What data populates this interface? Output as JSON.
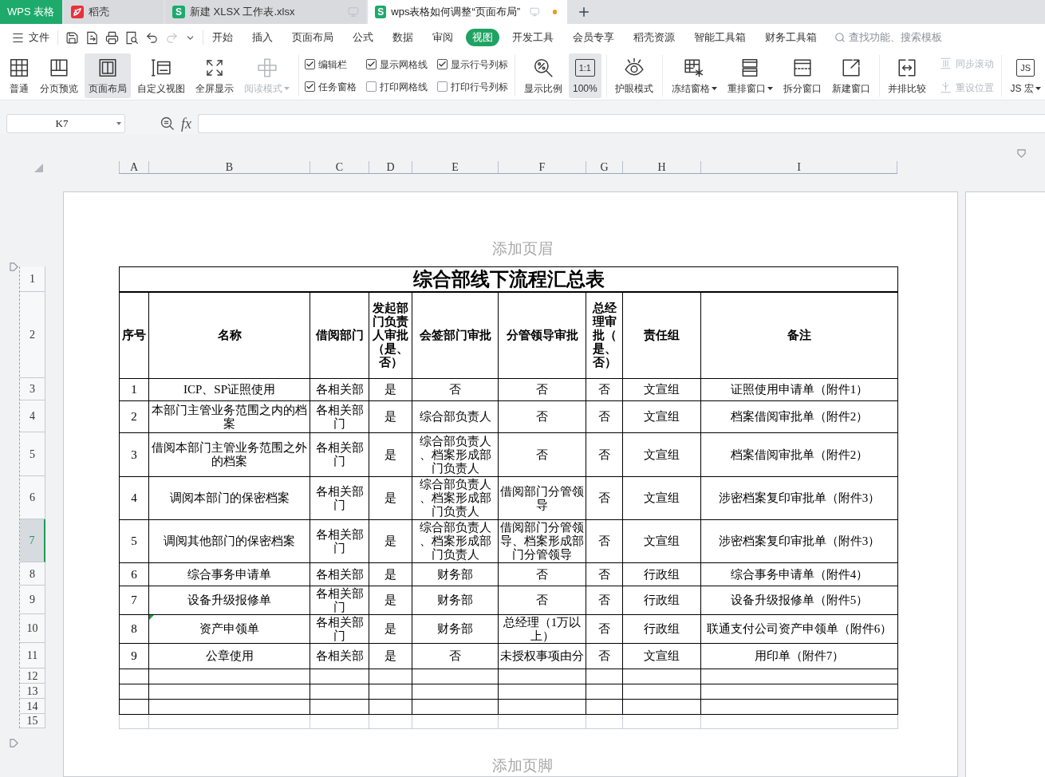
{
  "window_tabs": [
    {
      "kind": "app",
      "label": "WPS 表格",
      "selected": false,
      "unsaved": false
    },
    {
      "kind": "docer",
      "label": "稻壳",
      "selected": false,
      "unsaved": false
    },
    {
      "kind": "sheet",
      "icon_text": "S",
      "label": "新建 XLSX 工作表.xlsx",
      "selected": false,
      "unsaved": false
    },
    {
      "kind": "sheet",
      "icon_text": "S",
      "label": "wps表格如何调整“页面布局”",
      "selected": true,
      "unsaved": true
    }
  ],
  "menu_bar": {
    "file_label": "文件",
    "quick_access": [
      {
        "disabled": false
      },
      {
        "disabled": false
      },
      {
        "disabled": false
      },
      {
        "disabled": false
      },
      {
        "disabled": false
      },
      {
        "disabled": true
      }
    ],
    "tabs": [
      {
        "label": "开始",
        "selected": false
      },
      {
        "label": "插入",
        "selected": false
      },
      {
        "label": "页面布局",
        "selected": false
      },
      {
        "label": "公式",
        "selected": false
      },
      {
        "label": "数据",
        "selected": false
      },
      {
        "label": "审阅",
        "selected": false
      },
      {
        "label": "视图",
        "selected": true
      },
      {
        "label": "开发工具",
        "selected": false
      },
      {
        "label": "会员专享",
        "selected": false
      },
      {
        "label": "稻壳资源",
        "selected": false
      },
      {
        "label": "智能工具箱",
        "selected": false
      },
      {
        "label": "财务工具箱",
        "selected": false
      }
    ],
    "search": {
      "placeholder": "查找功能、搜索模板"
    }
  },
  "ribbon": {
    "groups": [
      {
        "items": [
          {
            "kind": "large",
            "label": "普通",
            "selected": false,
            "disabled": false,
            "has_menu": false
          },
          {
            "kind": "large",
            "label": "分页预览",
            "selected": false,
            "disabled": false,
            "has_menu": false
          },
          {
            "kind": "large",
            "label": "页面布局",
            "selected": true,
            "disabled": false,
            "has_menu": false
          },
          {
            "kind": "large",
            "label": "自定义视图",
            "selected": false,
            "disabled": false,
            "has_menu": false
          },
          {
            "kind": "large",
            "label": "全屏显示",
            "selected": false,
            "disabled": false,
            "has_menu": false
          },
          {
            "kind": "large",
            "label": "阅读模式",
            "selected": false,
            "disabled": true,
            "has_menu": true
          }
        ]
      },
      {
        "items": [
          {
            "kind": "checkbox",
            "label": "编辑栏",
            "checked": true
          },
          {
            "kind": "checkbox",
            "label": "显示网格线",
            "checked": true
          },
          {
            "kind": "checkbox",
            "label": "显示行号列标",
            "checked": true
          },
          {
            "kind": "checkbox",
            "label": "任务窗格",
            "checked": true
          },
          {
            "kind": "checkbox",
            "label": "打印网格线",
            "checked": false
          },
          {
            "kind": "checkbox",
            "label": "打印行号列标",
            "checked": false
          }
        ]
      },
      {
        "items": [
          {
            "kind": "large",
            "label": "显示比例",
            "selected": false,
            "disabled": false,
            "has_menu": false
          },
          {
            "kind": "large",
            "label": "100%",
            "icon_text": "1:1",
            "selected": true,
            "disabled": false,
            "has_menu": false
          }
        ]
      },
      {
        "items": [
          {
            "kind": "large",
            "label": "护眼模式",
            "selected": false,
            "disabled": false,
            "has_menu": false
          }
        ]
      },
      {
        "items": [
          {
            "kind": "large",
            "label": "冻结窗格",
            "selected": false,
            "disabled": false,
            "has_menu": true
          },
          {
            "kind": "large",
            "label": "重排窗口",
            "selected": false,
            "disabled": false,
            "has_menu": true
          },
          {
            "kind": "large",
            "label": "拆分窗口",
            "selected": false,
            "disabled": false,
            "has_menu": false
          },
          {
            "kind": "large",
            "label": "新建窗口",
            "selected": false,
            "disabled": false,
            "has_menu": false
          }
        ]
      },
      {
        "items": [
          {
            "kind": "large",
            "label": "并排比较",
            "selected": false,
            "disabled": false,
            "has_menu": false
          },
          {
            "kind": "small",
            "label": "同步滚动",
            "selected": false,
            "disabled": true,
            "has_menu": false
          },
          {
            "kind": "small",
            "label": "重设位置",
            "selected": false,
            "disabled": true,
            "has_menu": false
          }
        ]
      },
      {
        "items": [
          {
            "kind": "large",
            "label": "JS 宏",
            "icon_text": "JS",
            "selected": false,
            "disabled": false,
            "has_menu": true
          }
        ]
      }
    ]
  },
  "formula_bar": {
    "name_box": "K7",
    "fx_label": "fx"
  },
  "sheet": {
    "column_headers": [
      "A",
      "B",
      "C",
      "D",
      "E",
      "F",
      "G",
      "H",
      "I"
    ],
    "row_headers": [
      {
        "label": "1",
        "selected": false
      },
      {
        "label": "2",
        "selected": false
      },
      {
        "label": "3",
        "selected": false
      },
      {
        "label": "4",
        "selected": false
      },
      {
        "label": "5",
        "selected": false
      },
      {
        "label": "6",
        "selected": false
      },
      {
        "label": "7",
        "selected": true
      },
      {
        "label": "8",
        "selected": false
      },
      {
        "label": "9",
        "selected": false
      },
      {
        "label": "10",
        "selected": false
      },
      {
        "label": "11",
        "selected": false
      },
      {
        "label": "12",
        "selected": false
      },
      {
        "label": "13",
        "selected": false
      },
      {
        "label": "14",
        "selected": false
      },
      {
        "label": "15",
        "selected": false
      }
    ],
    "page_header": "添加页眉",
    "title": "综合部线下流程汇总表",
    "header_cells": [
      "序号",
      "名称",
      "借阅部门",
      "发起部门负责人审批（是、否）",
      "会签部门审批",
      "分管领导审批",
      "总经理审批（是、否）",
      "责任组",
      "备注"
    ],
    "rows": [
      {
        "cells": [
          "1",
          "ICP、SP证照使用",
          "各相关部",
          "是",
          "否",
          "否",
          "否",
          "文宣组",
          "证照使用申请单（附件1）"
        ],
        "error_marker": false
      },
      {
        "cells": [
          "2",
          "本部门主管业务范围之内的档案",
          "各相关部门",
          "是",
          "综合部负责人",
          "否",
          "否",
          "文宣组",
          "档案借阅审批单（附件2）"
        ],
        "error_marker": false
      },
      {
        "cells": [
          "3",
          "借阅本部门主管业务范围之外的档案",
          "各相关部门",
          "是",
          "综合部负责人、档案形成部门负责人",
          "否",
          "否",
          "文宣组",
          "档案借阅审批单（附件2）"
        ],
        "error_marker": false
      },
      {
        "cells": [
          "4",
          "调阅本部门的保密档案",
          "各相关部门",
          "是",
          "综合部负责人、档案形成部门负责人",
          "借阅部门分管领导",
          "否",
          "文宣组",
          "涉密档案复印审批单（附件3）"
        ],
        "error_marker": false
      },
      {
        "cells": [
          "5",
          "调阅其他部门的保密档案",
          "各相关部门",
          "是",
          "综合部负责人、档案形成部门负责人",
          "借阅部门分管领导、档案形成部门分管领导",
          "否",
          "文宣组",
          "涉密档案复印审批单（附件3）"
        ],
        "error_marker": false
      },
      {
        "cells": [
          "6",
          "综合事务申请单",
          "各相关部",
          "是",
          "财务部",
          "否",
          "否",
          "行政组",
          "综合事务申请单（附件4）"
        ],
        "error_marker": false
      },
      {
        "cells": [
          "7",
          "设备升级报修单",
          "各相关部门",
          "是",
          "财务部",
          "否",
          "否",
          "行政组",
          "设备升级报修单（附件5）"
        ],
        "error_marker": false
      },
      {
        "cells": [
          "8",
          "资产申领单",
          "各相关部门",
          "是",
          "财务部",
          "总经理（1万以上）",
          "否",
          "行政组",
          "联通支付公司资产申领单（附件6）"
        ],
        "error_marker": true
      },
      {
        "cells": [
          "9",
          "公章使用",
          "各相关部",
          "是",
          "否",
          "未授权事项由分",
          "否",
          "文宣组",
          "用印单（附件7）"
        ],
        "error_marker": false
      }
    ],
    "page_footer": "添加页脚"
  }
}
